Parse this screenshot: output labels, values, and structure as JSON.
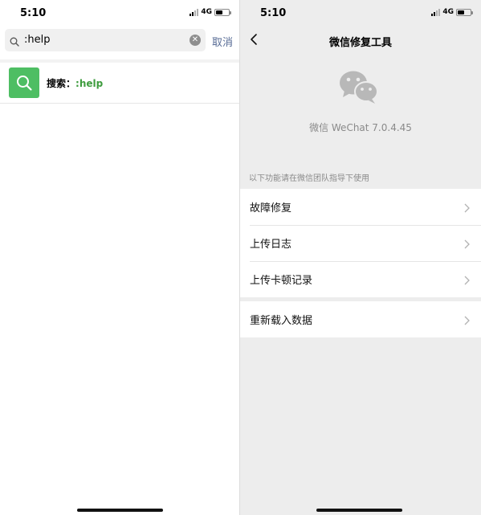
{
  "left_screen": {
    "status": {
      "time": "5:10",
      "network": "4G"
    },
    "search": {
      "query": ":help",
      "cancel_label": "取消"
    },
    "result": {
      "prefix": "搜索：",
      "keyword": ":help"
    }
  },
  "right_screen": {
    "status": {
      "time": "5:10",
      "network": "4G"
    },
    "nav": {
      "title": "微信修复工具"
    },
    "app_version": "微信 WeChat 7.0.4.45",
    "hint": "以下功能请在微信团队指导下使用",
    "menu_group_1": [
      {
        "label": "故障修复"
      },
      {
        "label": "上传日志"
      },
      {
        "label": "上传卡顿记录"
      }
    ],
    "menu_group_2": [
      {
        "label": "重新载入数据"
      }
    ]
  },
  "colors": {
    "accent_green": "#4ebe63",
    "keyword_green": "#3e9c3e",
    "link_blue": "#576b95",
    "background_gray": "#ededed"
  },
  "icons": [
    "search-icon",
    "clear-icon",
    "back-chevron-icon",
    "wechat-logo-icon",
    "chevron-right-icon",
    "signal-icon",
    "battery-icon"
  ]
}
